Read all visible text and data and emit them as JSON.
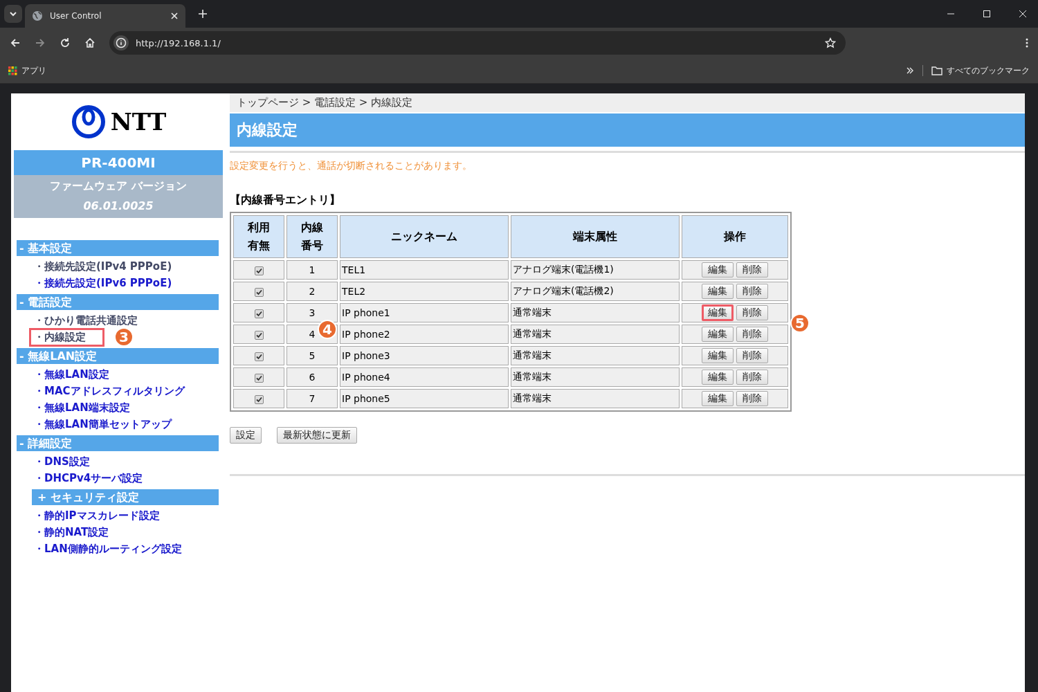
{
  "browser": {
    "tab_title": "User Control",
    "url": "http://192.168.1.1/",
    "bookmarks": [
      {
        "label": "アプリ"
      }
    ],
    "all_bookmarks": "すべてのブックマーク"
  },
  "sidebar": {
    "logo_text": "NTT",
    "model": "PR-400MI",
    "firmware_label": "ファームウェア バージョン",
    "firmware_version": "06.01.0025",
    "sections": [
      {
        "title": "- 基本設定",
        "indent": false,
        "items": [
          {
            "label": "・接続先設定(IPv4 PPPoE)",
            "visited": true,
            "highlighted": false
          },
          {
            "label": "・接続先設定(IPv6 PPPoE)",
            "visited": false,
            "highlighted": false
          }
        ]
      },
      {
        "title": "- 電話設定",
        "indent": false,
        "items": [
          {
            "label": "・ひかり電話共通設定",
            "visited": true,
            "highlighted": false
          },
          {
            "label": "・内線設定",
            "visited": true,
            "highlighted": true,
            "callout": "3"
          }
        ]
      },
      {
        "title": "- 無線LAN設定",
        "indent": false,
        "items": [
          {
            "label": "・無線LAN設定",
            "visited": false,
            "highlighted": false
          },
          {
            "label": "・MACアドレスフィルタリング",
            "visited": false,
            "highlighted": false
          },
          {
            "label": "・無線LAN端末設定",
            "visited": false,
            "highlighted": false
          },
          {
            "label": "・無線LAN簡単セットアップ",
            "visited": false,
            "highlighted": false
          }
        ]
      },
      {
        "title": "- 詳細設定",
        "indent": false,
        "items": [
          {
            "label": "・DNS設定",
            "visited": false,
            "highlighted": false
          },
          {
            "label": "・DHCPv4サーバ設定",
            "visited": false,
            "highlighted": false
          }
        ]
      },
      {
        "title": "+ セキュリティ設定",
        "indent": true,
        "items": [
          {
            "label": "・静的IPマスカレード設定",
            "visited": false,
            "highlighted": false
          },
          {
            "label": "・静的NAT設定",
            "visited": false,
            "highlighted": false
          },
          {
            "label": "・LAN側静的ルーティング設定",
            "visited": false,
            "highlighted": false
          }
        ]
      }
    ]
  },
  "breadcrumb": "トップページ > 電話設定 > 内線設定",
  "page_title": "内線設定",
  "warning": "設定変更を行うと、通話が切断されることがあります。",
  "table_title": "【内線番号エントリ】",
  "table": {
    "columns": [
      "利用有無",
      "内線番号",
      "ニックネーム",
      "端末属性",
      "操作"
    ],
    "rows": [
      {
        "enabled": true,
        "number": "1",
        "nickname": "TEL1",
        "terminal": "アナログ端末(電話機1)",
        "edit": "編集",
        "delete": "削除",
        "highlighted": false
      },
      {
        "enabled": true,
        "number": "2",
        "nickname": "TEL2",
        "terminal": "アナログ端末(電話機2)",
        "edit": "編集",
        "delete": "削除",
        "highlighted": false
      },
      {
        "enabled": true,
        "number": "3",
        "nickname": "IP phone1",
        "terminal": "通常端末",
        "edit": "編集",
        "delete": "削除",
        "highlighted": true,
        "callout": "5"
      },
      {
        "enabled": true,
        "number": "4",
        "nickname": "IP phone2",
        "terminal": "通常端末",
        "edit": "編集",
        "delete": "削除",
        "highlighted": false,
        "callout": "4"
      },
      {
        "enabled": true,
        "number": "5",
        "nickname": "IP phone3",
        "terminal": "通常端末",
        "edit": "編集",
        "delete": "削除",
        "highlighted": false
      },
      {
        "enabled": true,
        "number": "6",
        "nickname": "IP phone4",
        "terminal": "通常端末",
        "edit": "編集",
        "delete": "削除",
        "highlighted": false
      },
      {
        "enabled": true,
        "number": "7",
        "nickname": "IP phone5",
        "terminal": "通常端末",
        "edit": "編集",
        "delete": "削除",
        "highlighted": false
      }
    ]
  },
  "buttons": [
    "設定",
    "最新状態に更新"
  ]
}
